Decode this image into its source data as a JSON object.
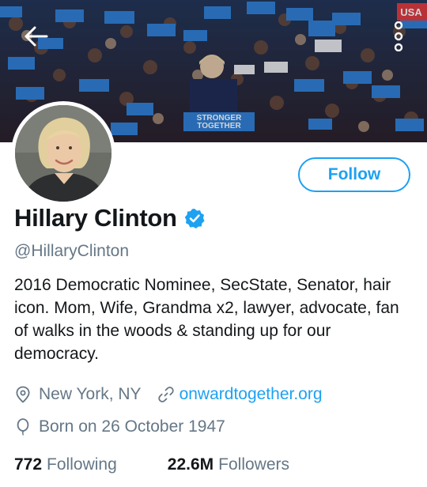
{
  "profile": {
    "banner_sign_text": [
      "STRONGER",
      "TOGETHER"
    ],
    "banner_usa_text": "USA",
    "name": "Hillary Clinton",
    "handle": "@HillaryClinton",
    "bio": "2016 Democratic Nominee, SecState, Senator, hair icon. Mom, Wife, Grandma x2, lawyer, advocate, fan of walks in the woods & standing up for our democracy.",
    "location": "New York, NY",
    "website": "onwardtogether.org",
    "birthday": "Born on 26 October 1947",
    "following_count": "772",
    "following_label": "Following",
    "followers_count": "22.6M",
    "followers_label": "Followers"
  },
  "actions": {
    "follow_label": "Follow"
  },
  "icons": {
    "back": "arrow-left-icon",
    "more": "more-vertical-icon",
    "verified": "verified-badge-icon",
    "location": "location-pin-icon",
    "link": "link-icon",
    "birthday": "balloon-icon"
  },
  "colors": {
    "accent": "#1da1f2",
    "text_primary": "#14171a",
    "text_secondary": "#657786",
    "sign_blue": "#2f7fd6"
  }
}
